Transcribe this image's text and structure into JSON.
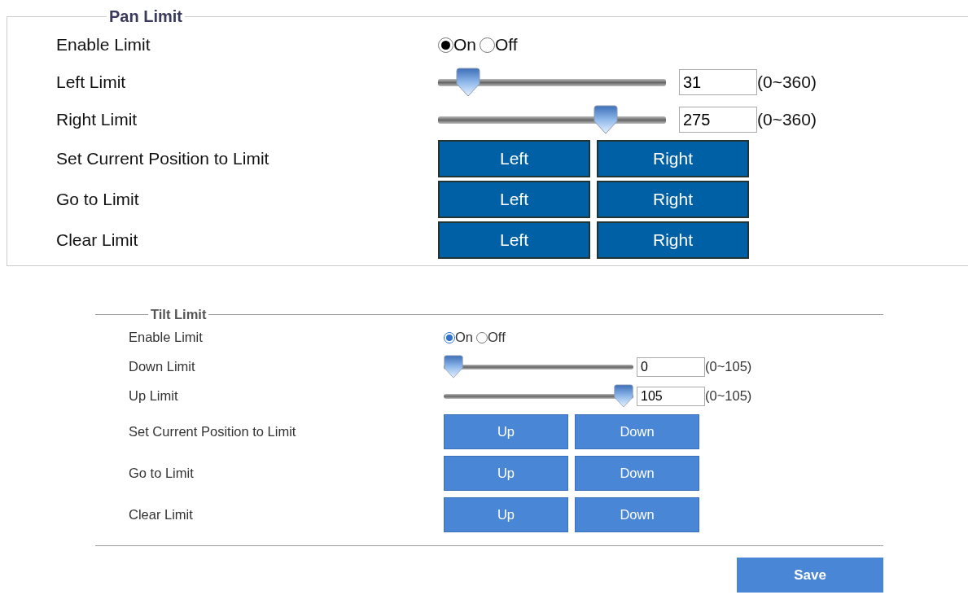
{
  "sections": [
    {
      "title": "Pan Limit",
      "rows": [
        {
          "kind": "radio",
          "label": "Enable Limit",
          "options": [
            {
              "label": "On",
              "selected": true
            },
            {
              "label": "Off",
              "selected": false
            }
          ]
        },
        {
          "kind": "slider",
          "label": "Left Limit",
          "level": 0.086,
          "value": "31",
          "range": "(0~360)"
        },
        {
          "kind": "slider",
          "label": "Right Limit",
          "level": 0.764,
          "value": "275",
          "range": "(0~360)"
        },
        {
          "kind": "buttons",
          "label": "Set Current Position to Limit",
          "buttons": [
            "Left",
            "Right"
          ]
        },
        {
          "kind": "buttons",
          "label": "Go to Limit",
          "buttons": [
            "Left",
            "Right"
          ]
        },
        {
          "kind": "buttons",
          "label": "Clear Limit",
          "buttons": [
            "Left",
            "Right"
          ]
        }
      ]
    },
    {
      "title": "Tilt Limit",
      "rows": [
        {
          "kind": "radio",
          "label": "Enable Limit",
          "options": [
            {
              "label": "On",
              "selected": true
            },
            {
              "label": "Off",
              "selected": false
            }
          ]
        },
        {
          "kind": "slider",
          "label": "Down Limit",
          "level": 0,
          "value": "0",
          "range": "(0~105)"
        },
        {
          "kind": "slider",
          "label": "Up Limit",
          "level": 1,
          "value": "105",
          "range": "(0~105)"
        },
        {
          "kind": "buttons",
          "label": "Set Current Position to Limit",
          "buttons": [
            "Up",
            "Down"
          ]
        },
        {
          "kind": "buttons",
          "label": "Go to Limit",
          "buttons": [
            "Up",
            "Down"
          ]
        },
        {
          "kind": "buttons",
          "label": "Clear Limit",
          "buttons": [
            "Up",
            "Down"
          ]
        }
      ]
    }
  ],
  "save_button": "Save"
}
